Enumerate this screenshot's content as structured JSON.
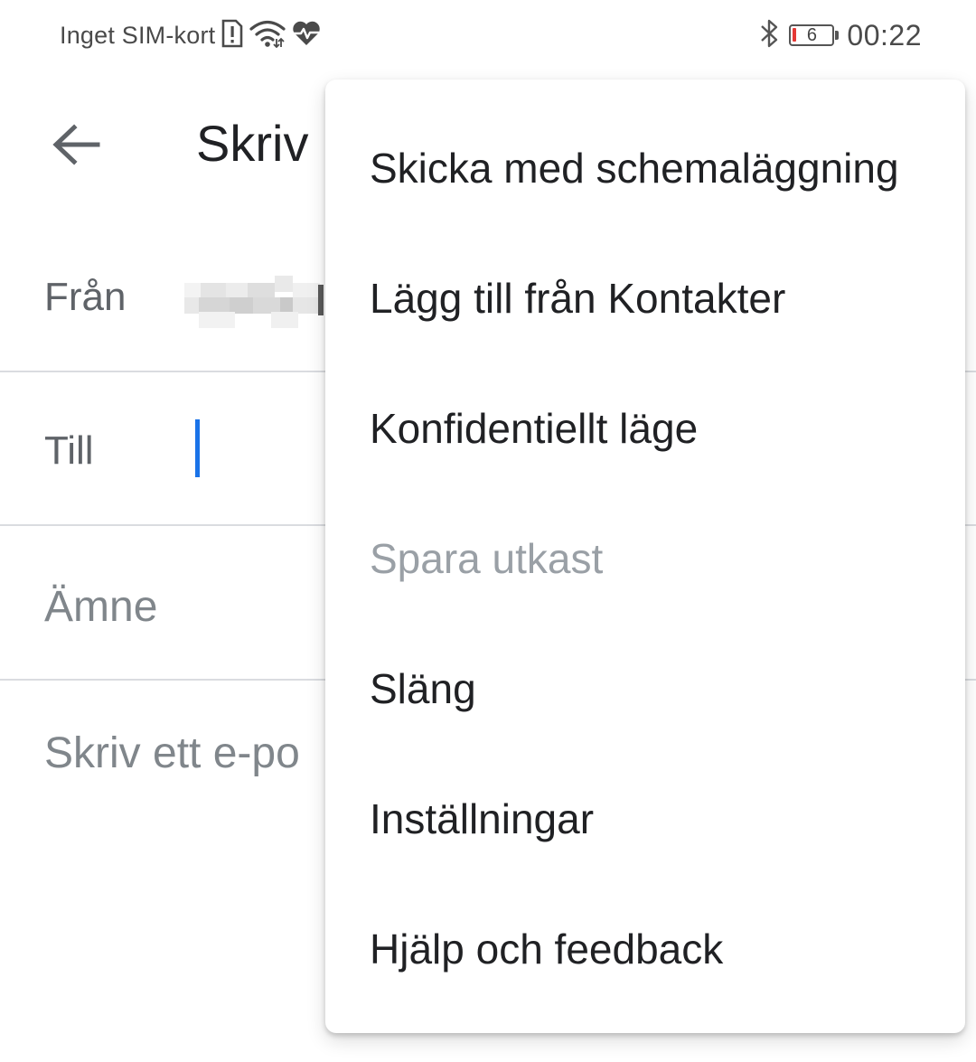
{
  "status_bar": {
    "carrier": "Inget SIM-kort",
    "battery_level": "6",
    "time": "00:22",
    "icons": [
      "sim-alert-icon",
      "wifi-icon",
      "health-heart-icon",
      "bluetooth-icon",
      "battery-icon"
    ]
  },
  "app_bar": {
    "title": "Skriv",
    "back_icon": "arrow-back-icon"
  },
  "compose": {
    "from_label": "Från",
    "to_label": "Till",
    "subject_placeholder": "Ämne",
    "body_placeholder": "Skriv ett e-po"
  },
  "menu": {
    "items": [
      {
        "label": "Skicka med schemaläggning",
        "enabled": true
      },
      {
        "label": "Lägg till från Kontakter",
        "enabled": true
      },
      {
        "label": "Konfidentiellt läge",
        "enabled": true
      },
      {
        "label": "Spara utkast",
        "enabled": false
      },
      {
        "label": "Släng",
        "enabled": true
      },
      {
        "label": "Inställningar",
        "enabled": true
      },
      {
        "label": "Hjälp och feedback",
        "enabled": true
      }
    ]
  },
  "colors": {
    "cursor": "#1a73e8",
    "battery_low": "#e53935",
    "disabled_text": "#9aa0a6",
    "divider": "#dadce0"
  }
}
